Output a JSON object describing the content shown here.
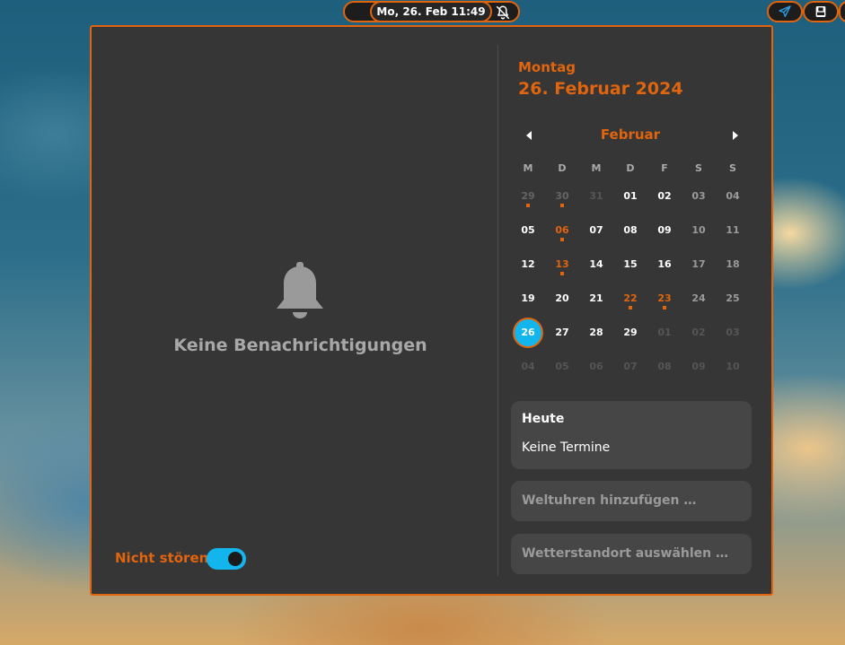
{
  "topbar": {
    "clock": "Mo, 26. Feb  11:49",
    "icons": [
      "bell-off-icon",
      "send-icon",
      "drive-icon"
    ]
  },
  "notifications": {
    "empty_text": "Keine Benachrichtigungen",
    "dnd_label": "Nicht stören",
    "dnd_enabled": true
  },
  "calendar": {
    "weekday": "Montag",
    "full_date": "26. Februar 2024",
    "month": "Februar",
    "weekday_headers": [
      "M",
      "D",
      "M",
      "D",
      "F",
      "S",
      "S"
    ],
    "weeks": [
      [
        {
          "d": "29",
          "other": true,
          "dot": true
        },
        {
          "d": "30",
          "other": true,
          "dot": true
        },
        {
          "d": "31",
          "other": true,
          "faint": true
        },
        {
          "d": "01"
        },
        {
          "d": "02"
        },
        {
          "d": "03",
          "we": true
        },
        {
          "d": "04",
          "we": true
        }
      ],
      [
        {
          "d": "05"
        },
        {
          "d": "06",
          "holiday": true,
          "dot": true
        },
        {
          "d": "07"
        },
        {
          "d": "08"
        },
        {
          "d": "09"
        },
        {
          "d": "10",
          "we": true
        },
        {
          "d": "11",
          "we": true
        }
      ],
      [
        {
          "d": "12"
        },
        {
          "d": "13",
          "holiday": true,
          "dot": true
        },
        {
          "d": "14"
        },
        {
          "d": "15"
        },
        {
          "d": "16"
        },
        {
          "d": "17",
          "we": true
        },
        {
          "d": "18",
          "we": true
        }
      ],
      [
        {
          "d": "19"
        },
        {
          "d": "20"
        },
        {
          "d": "21"
        },
        {
          "d": "22",
          "holiday": true,
          "dot": true
        },
        {
          "d": "23",
          "holiday": true,
          "dot": true
        },
        {
          "d": "24",
          "we": true
        },
        {
          "d": "25",
          "we": true
        }
      ],
      [
        {
          "d": "26",
          "today": true
        },
        {
          "d": "27"
        },
        {
          "d": "28"
        },
        {
          "d": "29"
        },
        {
          "d": "01",
          "other": true,
          "faint": true
        },
        {
          "d": "02",
          "other": true,
          "faint": true
        },
        {
          "d": "03",
          "other": true,
          "faint": true
        }
      ],
      [
        {
          "d": "04",
          "other": true,
          "faint": true
        },
        {
          "d": "05",
          "other": true,
          "faint": true
        },
        {
          "d": "06",
          "other": true,
          "faint": true
        },
        {
          "d": "07",
          "other": true,
          "faint": true
        },
        {
          "d": "08",
          "other": true,
          "faint": true
        },
        {
          "d": "09",
          "other": true,
          "faint": true
        },
        {
          "d": "10",
          "other": true,
          "faint": true
        }
      ]
    ]
  },
  "events": {
    "title": "Heute",
    "empty": "Keine Termine"
  },
  "actions": {
    "world_clocks": "Weltuhren hinzufügen …",
    "weather": "Wetterstandort auswählen …"
  },
  "colors": {
    "accent": "#e0650e",
    "toggle_on": "#12b5ec",
    "panel_bg": "#363636"
  }
}
